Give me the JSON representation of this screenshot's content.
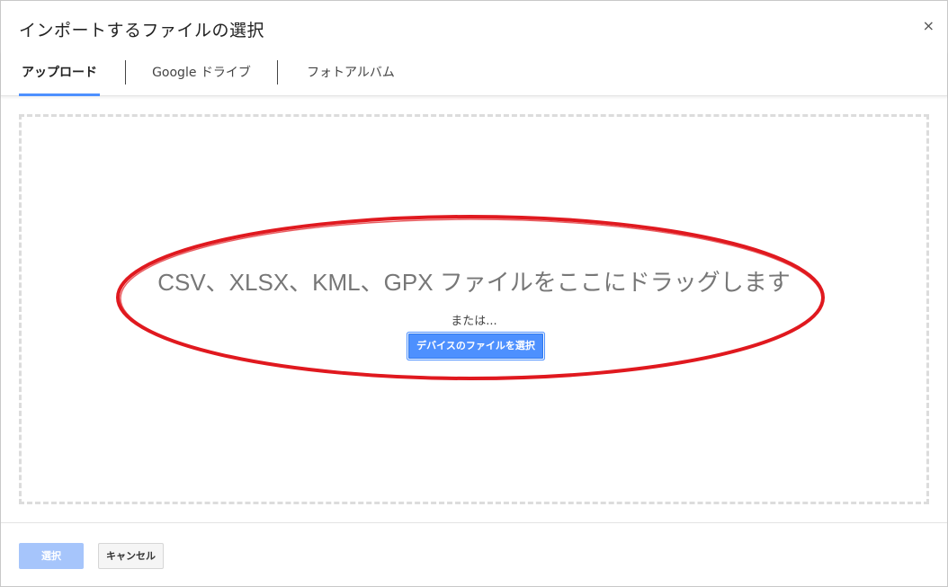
{
  "dialog": {
    "title": "インポートするファイルの選択",
    "close_label": "×"
  },
  "tabs": [
    {
      "label": "アップロード",
      "active": true
    },
    {
      "label": "Google ドライブ",
      "active": false
    },
    {
      "label": "フォトアルバム",
      "active": false
    }
  ],
  "dropzone": {
    "headline": "CSV、XLSX、KML、GPX ファイルをここにドラッグします",
    "or_text": "または...",
    "device_button_label": "デバイスのファイルを選択"
  },
  "footer": {
    "select_label": "選択",
    "cancel_label": "キャンセル"
  },
  "colors": {
    "accent": "#4d90fe",
    "select_disabled": "#a6c5fb",
    "annotation": "#e0191f"
  }
}
